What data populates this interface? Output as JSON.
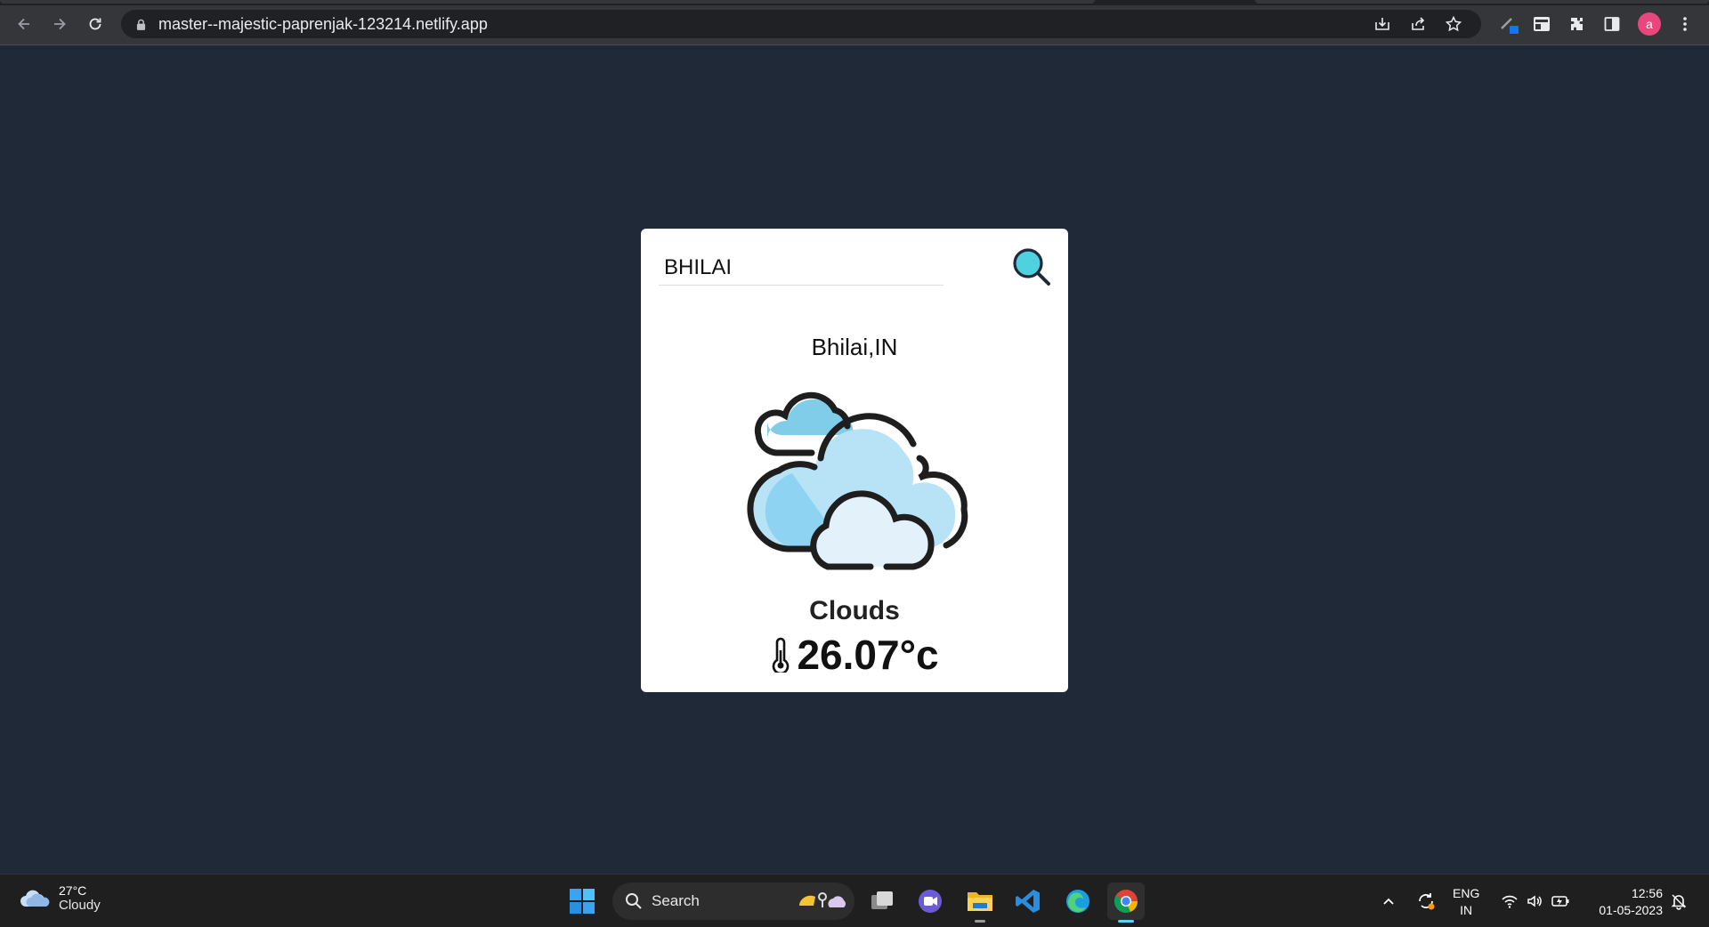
{
  "browser": {
    "url": "master--majestic-paprenjak-123214.netlify.app",
    "profile_initial": "a",
    "icons": [
      "back-icon",
      "forward-icon",
      "reload-icon",
      "lock-icon",
      "install-icon",
      "share-icon",
      "star-icon",
      "pen-extension-icon",
      "tab-extension-icon",
      "puzzle-icon",
      "sidepanel-icon",
      "menu-icon"
    ]
  },
  "weather_app": {
    "search_value": "BHILAI",
    "location": "Bhilai,IN",
    "condition": "Clouds",
    "temperature": "26.07°c",
    "icons": [
      "search-icon",
      "clouds-icon",
      "thermometer-icon"
    ],
    "accent_color": "#4fd1e0"
  },
  "taskbar": {
    "weather_temp": "27°C",
    "weather_desc": "Cloudy",
    "search_label": "Search",
    "language": "ENG",
    "region": "IN",
    "time": "12:56",
    "date": "01-05-2023",
    "apps": [
      "start-icon",
      "task-view-icon",
      "meet-icon",
      "file-explorer-icon",
      "vscode-icon",
      "edge-icon",
      "chrome-icon"
    ]
  }
}
